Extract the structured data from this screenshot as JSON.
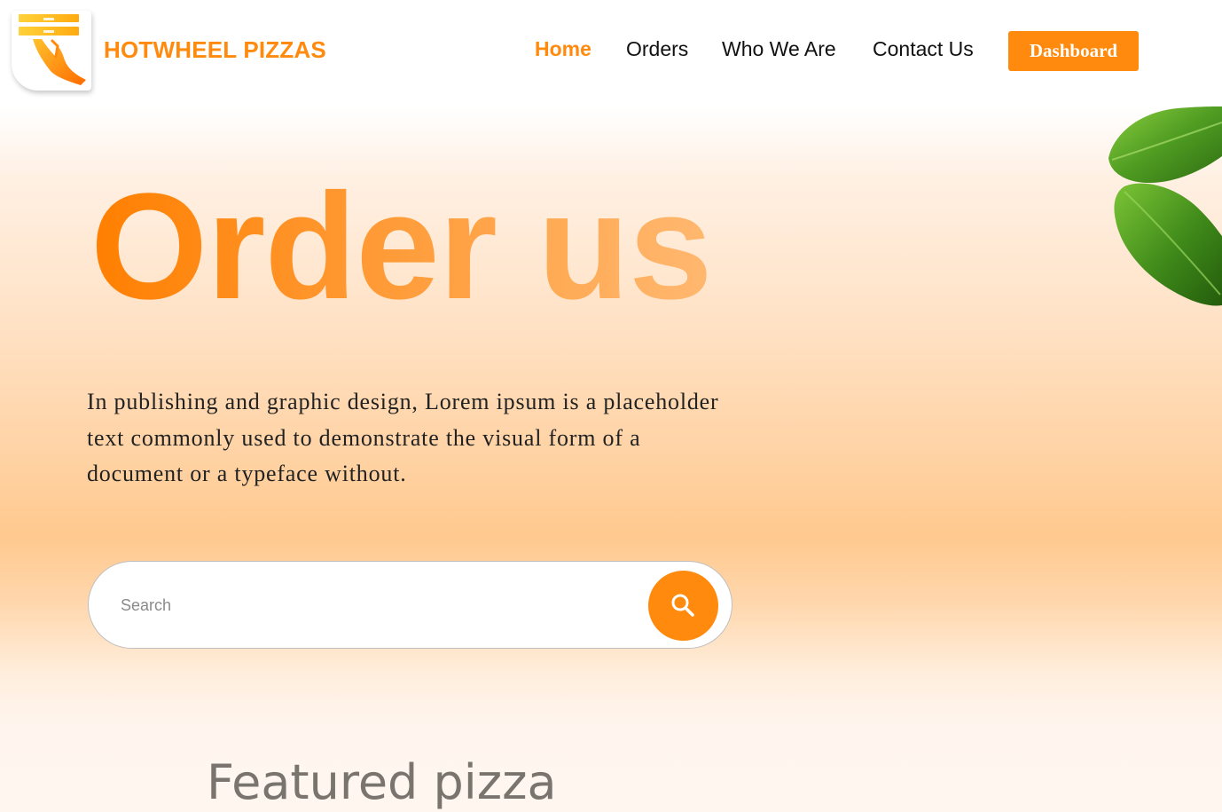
{
  "header": {
    "logo_icon": "pizza-box-delivery-hand-icon",
    "brand": "HOTWHEEL PIZZAS",
    "nav": [
      {
        "label": "Home",
        "active": true
      },
      {
        "label": "Orders",
        "active": false
      },
      {
        "label": "Who We Are",
        "active": false
      },
      {
        "label": "Contact Us",
        "active": false
      }
    ],
    "dashboard_label": "Dashboard"
  },
  "hero": {
    "title": "Order us",
    "description": "In publishing and graphic design, Lorem ipsum is a placeholder text commonly used to demonstrate the visual form of a document or a typeface without.",
    "search": {
      "placeholder": "Search",
      "value": "",
      "button_icon": "search-icon"
    },
    "decoration": "basil-leaves-image"
  },
  "featured": {
    "title": "Featured pizza"
  },
  "colors": {
    "accent": "#ff8a0d",
    "text_dark": "#111111",
    "featured_title": "#7a746f"
  }
}
